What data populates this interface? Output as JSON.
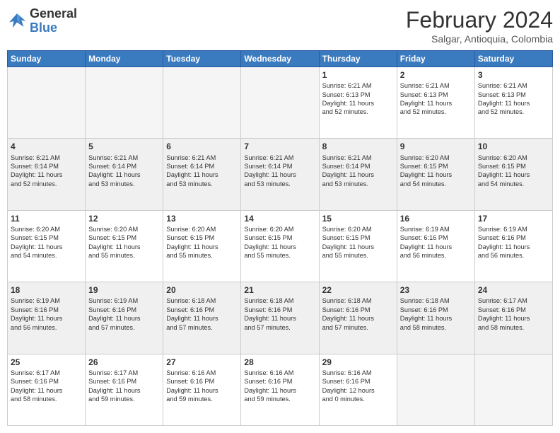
{
  "logo": {
    "general": "General",
    "blue": "Blue"
  },
  "header": {
    "month_title": "February 2024",
    "subtitle": "Salgar, Antioquia, Colombia"
  },
  "days_of_week": [
    "Sunday",
    "Monday",
    "Tuesday",
    "Wednesday",
    "Thursday",
    "Friday",
    "Saturday"
  ],
  "weeks": [
    [
      {
        "day": "",
        "info": ""
      },
      {
        "day": "",
        "info": ""
      },
      {
        "day": "",
        "info": ""
      },
      {
        "day": "",
        "info": ""
      },
      {
        "day": "1",
        "info": "Sunrise: 6:21 AM\nSunset: 6:13 PM\nDaylight: 11 hours\nand 52 minutes."
      },
      {
        "day": "2",
        "info": "Sunrise: 6:21 AM\nSunset: 6:13 PM\nDaylight: 11 hours\nand 52 minutes."
      },
      {
        "day": "3",
        "info": "Sunrise: 6:21 AM\nSunset: 6:13 PM\nDaylight: 11 hours\nand 52 minutes."
      }
    ],
    [
      {
        "day": "4",
        "info": "Sunrise: 6:21 AM\nSunset: 6:14 PM\nDaylight: 11 hours\nand 52 minutes."
      },
      {
        "day": "5",
        "info": "Sunrise: 6:21 AM\nSunset: 6:14 PM\nDaylight: 11 hours\nand 53 minutes."
      },
      {
        "day": "6",
        "info": "Sunrise: 6:21 AM\nSunset: 6:14 PM\nDaylight: 11 hours\nand 53 minutes."
      },
      {
        "day": "7",
        "info": "Sunrise: 6:21 AM\nSunset: 6:14 PM\nDaylight: 11 hours\nand 53 minutes."
      },
      {
        "day": "8",
        "info": "Sunrise: 6:21 AM\nSunset: 6:14 PM\nDaylight: 11 hours\nand 53 minutes."
      },
      {
        "day": "9",
        "info": "Sunrise: 6:20 AM\nSunset: 6:15 PM\nDaylight: 11 hours\nand 54 minutes."
      },
      {
        "day": "10",
        "info": "Sunrise: 6:20 AM\nSunset: 6:15 PM\nDaylight: 11 hours\nand 54 minutes."
      }
    ],
    [
      {
        "day": "11",
        "info": "Sunrise: 6:20 AM\nSunset: 6:15 PM\nDaylight: 11 hours\nand 54 minutes."
      },
      {
        "day": "12",
        "info": "Sunrise: 6:20 AM\nSunset: 6:15 PM\nDaylight: 11 hours\nand 55 minutes."
      },
      {
        "day": "13",
        "info": "Sunrise: 6:20 AM\nSunset: 6:15 PM\nDaylight: 11 hours\nand 55 minutes."
      },
      {
        "day": "14",
        "info": "Sunrise: 6:20 AM\nSunset: 6:15 PM\nDaylight: 11 hours\nand 55 minutes."
      },
      {
        "day": "15",
        "info": "Sunrise: 6:20 AM\nSunset: 6:15 PM\nDaylight: 11 hours\nand 55 minutes."
      },
      {
        "day": "16",
        "info": "Sunrise: 6:19 AM\nSunset: 6:16 PM\nDaylight: 11 hours\nand 56 minutes."
      },
      {
        "day": "17",
        "info": "Sunrise: 6:19 AM\nSunset: 6:16 PM\nDaylight: 11 hours\nand 56 minutes."
      }
    ],
    [
      {
        "day": "18",
        "info": "Sunrise: 6:19 AM\nSunset: 6:16 PM\nDaylight: 11 hours\nand 56 minutes."
      },
      {
        "day": "19",
        "info": "Sunrise: 6:19 AM\nSunset: 6:16 PM\nDaylight: 11 hours\nand 57 minutes."
      },
      {
        "day": "20",
        "info": "Sunrise: 6:18 AM\nSunset: 6:16 PM\nDaylight: 11 hours\nand 57 minutes."
      },
      {
        "day": "21",
        "info": "Sunrise: 6:18 AM\nSunset: 6:16 PM\nDaylight: 11 hours\nand 57 minutes."
      },
      {
        "day": "22",
        "info": "Sunrise: 6:18 AM\nSunset: 6:16 PM\nDaylight: 11 hours\nand 57 minutes."
      },
      {
        "day": "23",
        "info": "Sunrise: 6:18 AM\nSunset: 6:16 PM\nDaylight: 11 hours\nand 58 minutes."
      },
      {
        "day": "24",
        "info": "Sunrise: 6:17 AM\nSunset: 6:16 PM\nDaylight: 11 hours\nand 58 minutes."
      }
    ],
    [
      {
        "day": "25",
        "info": "Sunrise: 6:17 AM\nSunset: 6:16 PM\nDaylight: 11 hours\nand 58 minutes."
      },
      {
        "day": "26",
        "info": "Sunrise: 6:17 AM\nSunset: 6:16 PM\nDaylight: 11 hours\nand 59 minutes."
      },
      {
        "day": "27",
        "info": "Sunrise: 6:16 AM\nSunset: 6:16 PM\nDaylight: 11 hours\nand 59 minutes."
      },
      {
        "day": "28",
        "info": "Sunrise: 6:16 AM\nSunset: 6:16 PM\nDaylight: 11 hours\nand 59 minutes."
      },
      {
        "day": "29",
        "info": "Sunrise: 6:16 AM\nSunset: 6:16 PM\nDaylight: 12 hours\nand 0 minutes."
      },
      {
        "day": "",
        "info": ""
      },
      {
        "day": "",
        "info": ""
      }
    ]
  ]
}
